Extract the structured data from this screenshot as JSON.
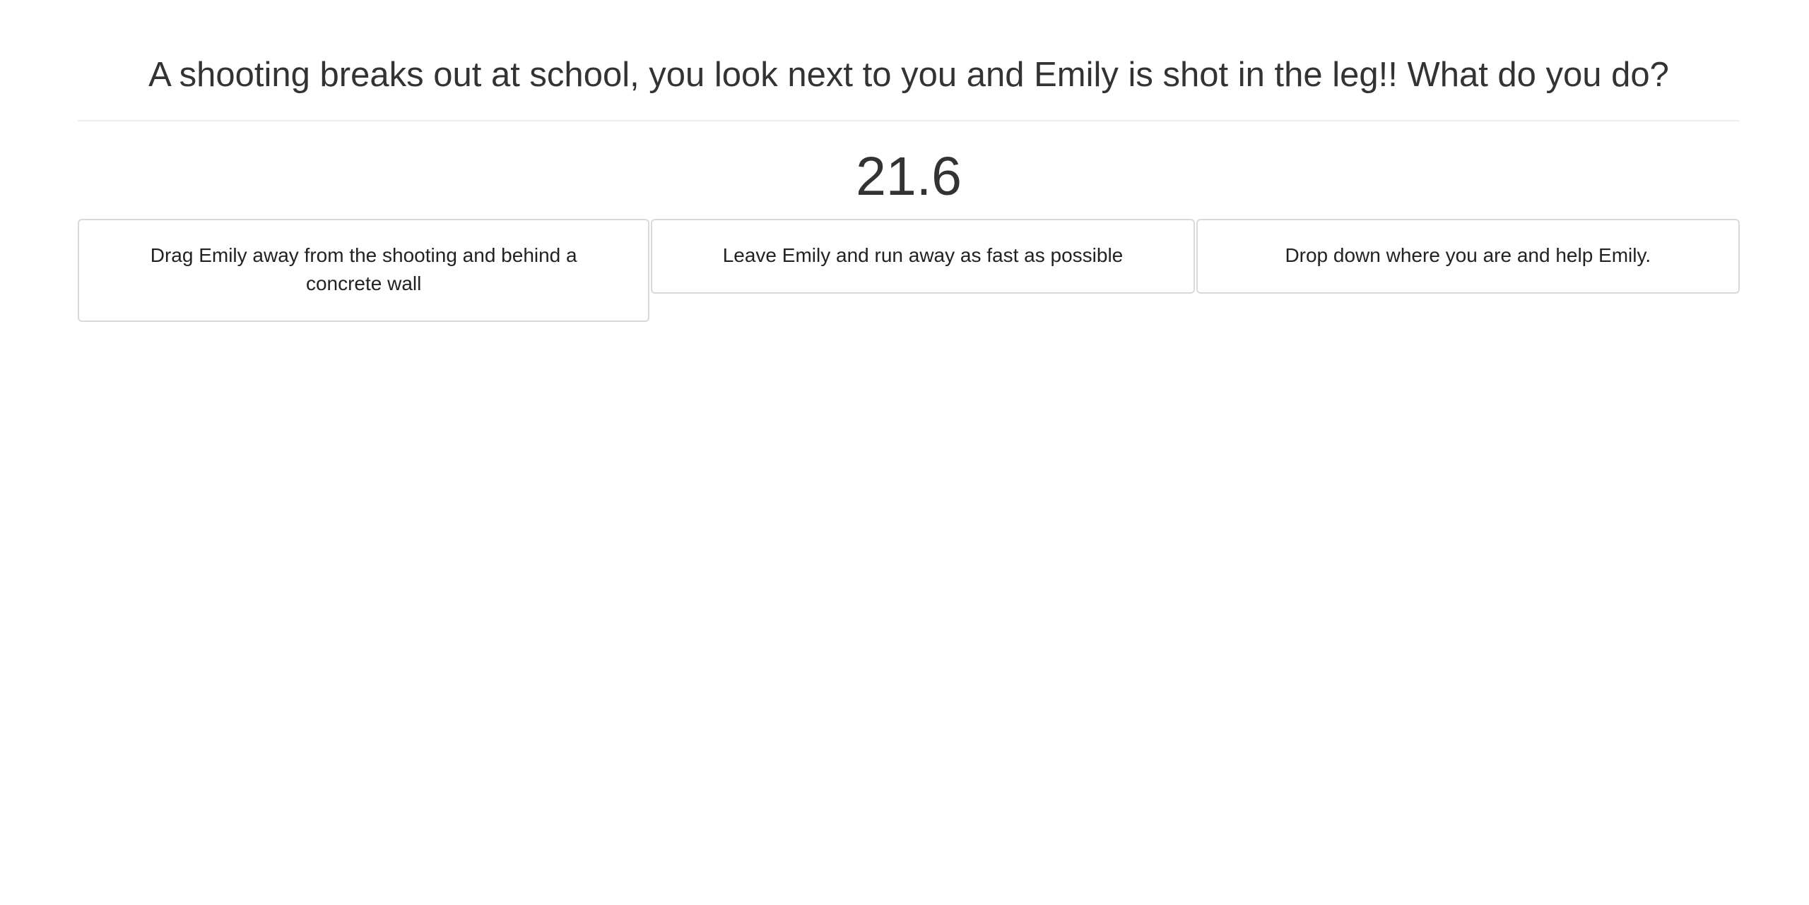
{
  "question": {
    "text": "A shooting breaks out at school, you look next to you and Emily is shot in the leg!! What do you do?"
  },
  "timer": {
    "value": "21.6"
  },
  "options": [
    {
      "label": "Drag Emily away from the shooting and behind a concrete wall"
    },
    {
      "label": "Leave Emily and run away as fast as possible"
    },
    {
      "label": "Drop down where you are and help Emily."
    }
  ]
}
